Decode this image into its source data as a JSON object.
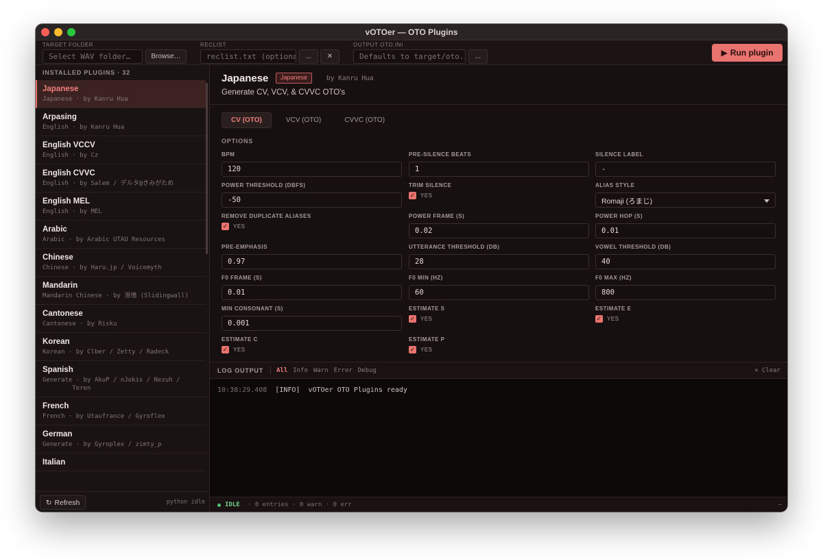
{
  "window": {
    "title": "vOTOer — OTO Plugins"
  },
  "toolbar": {
    "target_label": "TARGET FOLDER",
    "target_placeholder": "Select WAV folder…",
    "browse_label": "Browse…",
    "reclist_label": "RECLIST",
    "reclist_placeholder": "reclist.txt (optional)",
    "reclist_more": "...",
    "reclist_clear": "✕",
    "output_label": "OUTPUT OTO.INI",
    "output_placeholder": "Defaults to target/oto.ini",
    "output_more": "...",
    "run_label": "Run plugin",
    "run_icon": "▶"
  },
  "sidebar": {
    "header": "INSTALLED PLUGINS · 32",
    "plugins": [
      {
        "name": "Japanese",
        "meta": "Japanese · by Kanru Hua"
      },
      {
        "name": "Arpasing",
        "meta": "English · by Kanru Hua"
      },
      {
        "name": "English VCCV",
        "meta": "English · by Cz"
      },
      {
        "name": "English CVVC",
        "meta": "English · by Salem / デルタ@きみがため"
      },
      {
        "name": "English MEL",
        "meta": "English · by MEL"
      },
      {
        "name": "Arabic",
        "meta": "Arabic · by Arabic UTAU Resources"
      },
      {
        "name": "Chinese",
        "meta": "Chinese · by Haru.jp / Voicemyth"
      },
      {
        "name": "Mandarin",
        "meta": "Mandarin Chinese · by 滑墙 (Slidingwall)"
      },
      {
        "name": "Cantonese",
        "meta": "Cantonese · by Risku"
      },
      {
        "name": "Korean",
        "meta": "Korean · by Clber / Zetty / Radeck"
      },
      {
        "name": "Spanish",
        "meta": "Generate · by AkuP / nJokis / Nezuh /\n        Teren"
      },
      {
        "name": "French",
        "meta": "French · by Utaufrance / Gyroflex"
      },
      {
        "name": "German",
        "meta": "Generate · by Gyroplex / zimty_p"
      },
      {
        "name": "Italian",
        "meta": ""
      }
    ],
    "refresh_icon": "↻",
    "refresh_label": "Refresh",
    "status": "python idle"
  },
  "plugin": {
    "title": "Japanese",
    "badge": "Japanese",
    "author": "by Kanru Hua",
    "description": "Generate CV, VCV, & CVVC OTO's"
  },
  "tabs": [
    "CV (OTO)",
    "VCV (OTO)",
    "CVVC (OTO)"
  ],
  "options": {
    "heading": "OPTIONS",
    "bpm": {
      "label": "BPM",
      "value": "120"
    },
    "pre_silence": {
      "label": "PRE-SILENCE BEATS",
      "value": "1"
    },
    "silence_label": {
      "label": "SILENCE LABEL",
      "value": "-"
    },
    "power_threshold": {
      "label": "POWER THRESHOLD (DBFS)",
      "value": "-50"
    },
    "trim_silence": {
      "label": "TRIM SILENCE",
      "check": "YES"
    },
    "alias_style": {
      "label": "ALIAS STYLE",
      "value": "Romaji (ろまじ)"
    },
    "remove_dup": {
      "label": "REMOVE DUPLICATE ALIASES",
      "check": "YES"
    },
    "power_frame": {
      "label": "POWER FRAME (S)",
      "value": "0.02"
    },
    "power_hop": {
      "label": "POWER HOP (S)",
      "value": "0.01"
    },
    "pre_emphasis": {
      "label": "PRE-EMPHASIS",
      "value": "0.97"
    },
    "utterance_threshold": {
      "label": "UTTERANCE THRESHOLD (DB)",
      "value": "28"
    },
    "vowel_threshold": {
      "label": "VOWEL THRESHOLD (DB)",
      "value": "40"
    },
    "f0_frame": {
      "label": "F0 FRAME (S)",
      "value": "0.01"
    },
    "f0_min": {
      "label": "F0 MIN (HZ)",
      "value": "60"
    },
    "f0_max": {
      "label": "F0 MAX (HZ)",
      "value": "800"
    },
    "min_consonant": {
      "label": "MIN CONSONANT (S)",
      "value": "0.001"
    },
    "estimate_s": {
      "label": "ESTIMATE S",
      "check": "YES"
    },
    "estimate_e": {
      "label": "ESTIMATE E",
      "check": "YES"
    },
    "estimate_c": {
      "label": "ESTIMATE C",
      "check": "YES"
    },
    "estimate_p": {
      "label": "ESTIMATE P",
      "check": "YES"
    }
  },
  "log": {
    "title": "LOG OUTPUT",
    "filters": [
      "All",
      "Info",
      "Warn",
      "Error",
      "Debug"
    ],
    "clear": "✕ Clear",
    "line_time": "10:38:29.408",
    "line_level": "[INFO]",
    "line_msg": "vOTOer OTO Plugins ready"
  },
  "status": {
    "state": "IDLE",
    "info": "·  0 entries · 0 warn · 0 err",
    "end": "–"
  },
  "colors": {
    "accent": "#e8736f",
    "idle": "#4cc36a"
  }
}
